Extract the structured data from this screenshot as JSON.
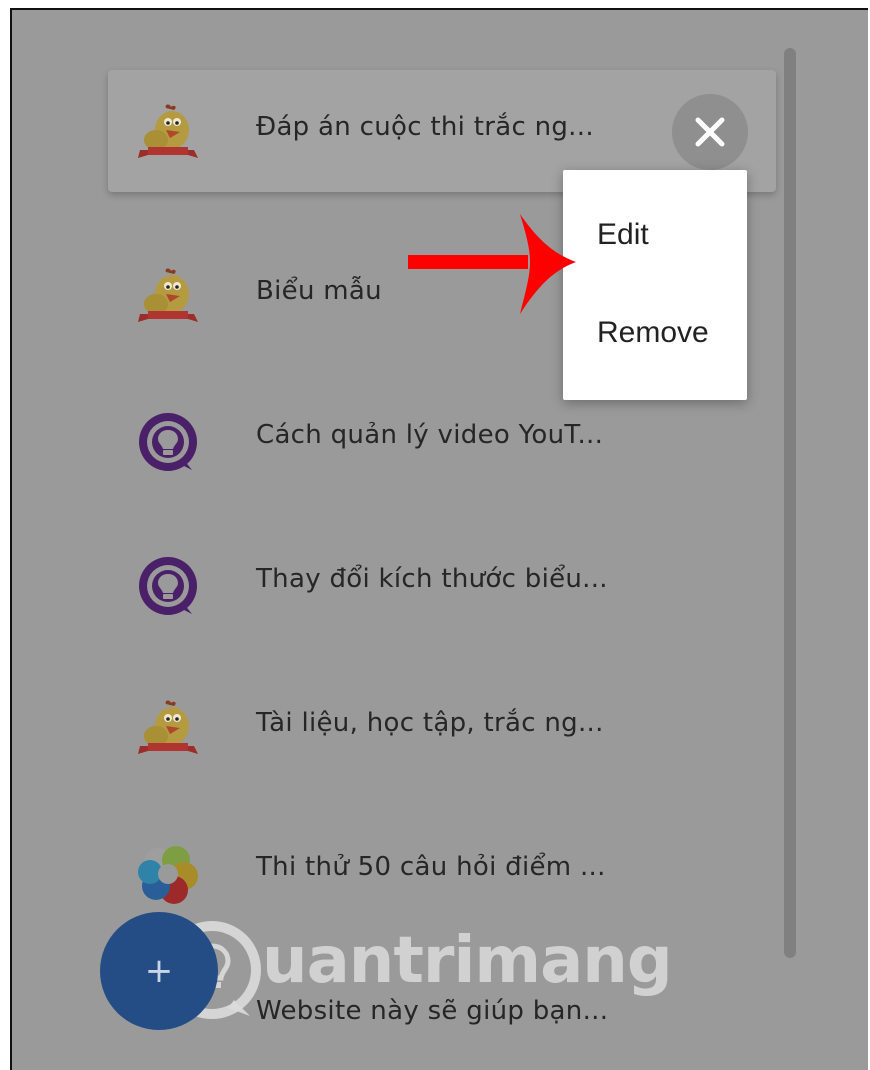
{
  "list": {
    "items": [
      {
        "label": "Đáp án cuộc thi trắc ng...",
        "icon": "chicken-logo-icon"
      },
      {
        "label": "Biểu mẫu",
        "icon": "chicken-logo-icon"
      },
      {
        "label": "Cách quản lý video YouT...",
        "icon": "lightbulb-logo-icon"
      },
      {
        "label": "Thay đổi kích thước biểu...",
        "icon": "lightbulb-logo-icon"
      },
      {
        "label": "Tài liệu, học tập, trắc ng...",
        "icon": "chicken-logo-icon"
      },
      {
        "label": "Thi thử 50 câu hỏi điểm ...",
        "icon": "colorful-pinwheel-icon"
      },
      {
        "label": "Website này sẽ giúp bạn...",
        "icon": "globe-icon"
      }
    ]
  },
  "context_menu": {
    "edit_label": "Edit",
    "remove_label": "Remove"
  },
  "fab": {
    "label": "+"
  },
  "watermark": {
    "text": "uantrimang"
  },
  "colors": {
    "overlay": "#9a9a9a",
    "fab": "#244d86",
    "arrow": "#ff0000",
    "lightbulb_purple": "#4a2068"
  }
}
